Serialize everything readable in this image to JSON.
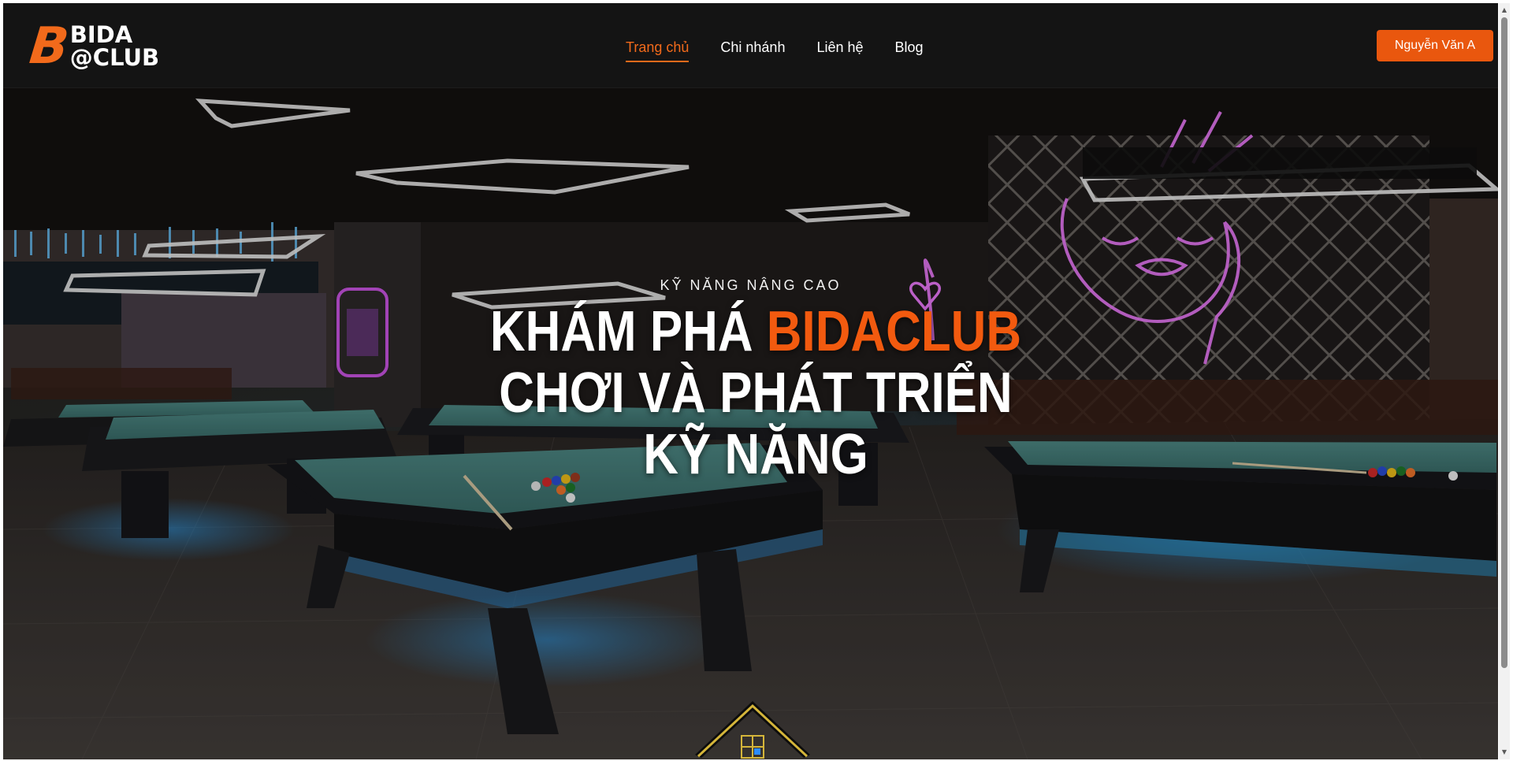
{
  "brand": {
    "mark": "B",
    "line1": "BIDA",
    "line2": "@CLUB",
    "accent_color": "#f26a1b"
  },
  "nav": {
    "items": [
      {
        "label": "Trang chủ",
        "active": true
      },
      {
        "label": "Chi nhánh",
        "active": false
      },
      {
        "label": "Liên hệ",
        "active": false
      },
      {
        "label": "Blog",
        "active": false
      }
    ]
  },
  "user": {
    "button_label": "Nguyễn Văn A",
    "button_color": "#e9570e"
  },
  "hero": {
    "kicker": "KỸ NĂNG NÂNG CAO",
    "title_prefix": "KHÁM PHÁ",
    "title_accent": "BIDACLUB",
    "title_rest": "CHƠI VÀ PHÁT TRIỂN KỸ NĂNG",
    "background_description_icon": "billiard-hall-photo",
    "home_icon": "house-icon"
  },
  "scrollbar": {
    "up_icon": "chevron-up-icon",
    "down_icon": "chevron-down-icon"
  }
}
